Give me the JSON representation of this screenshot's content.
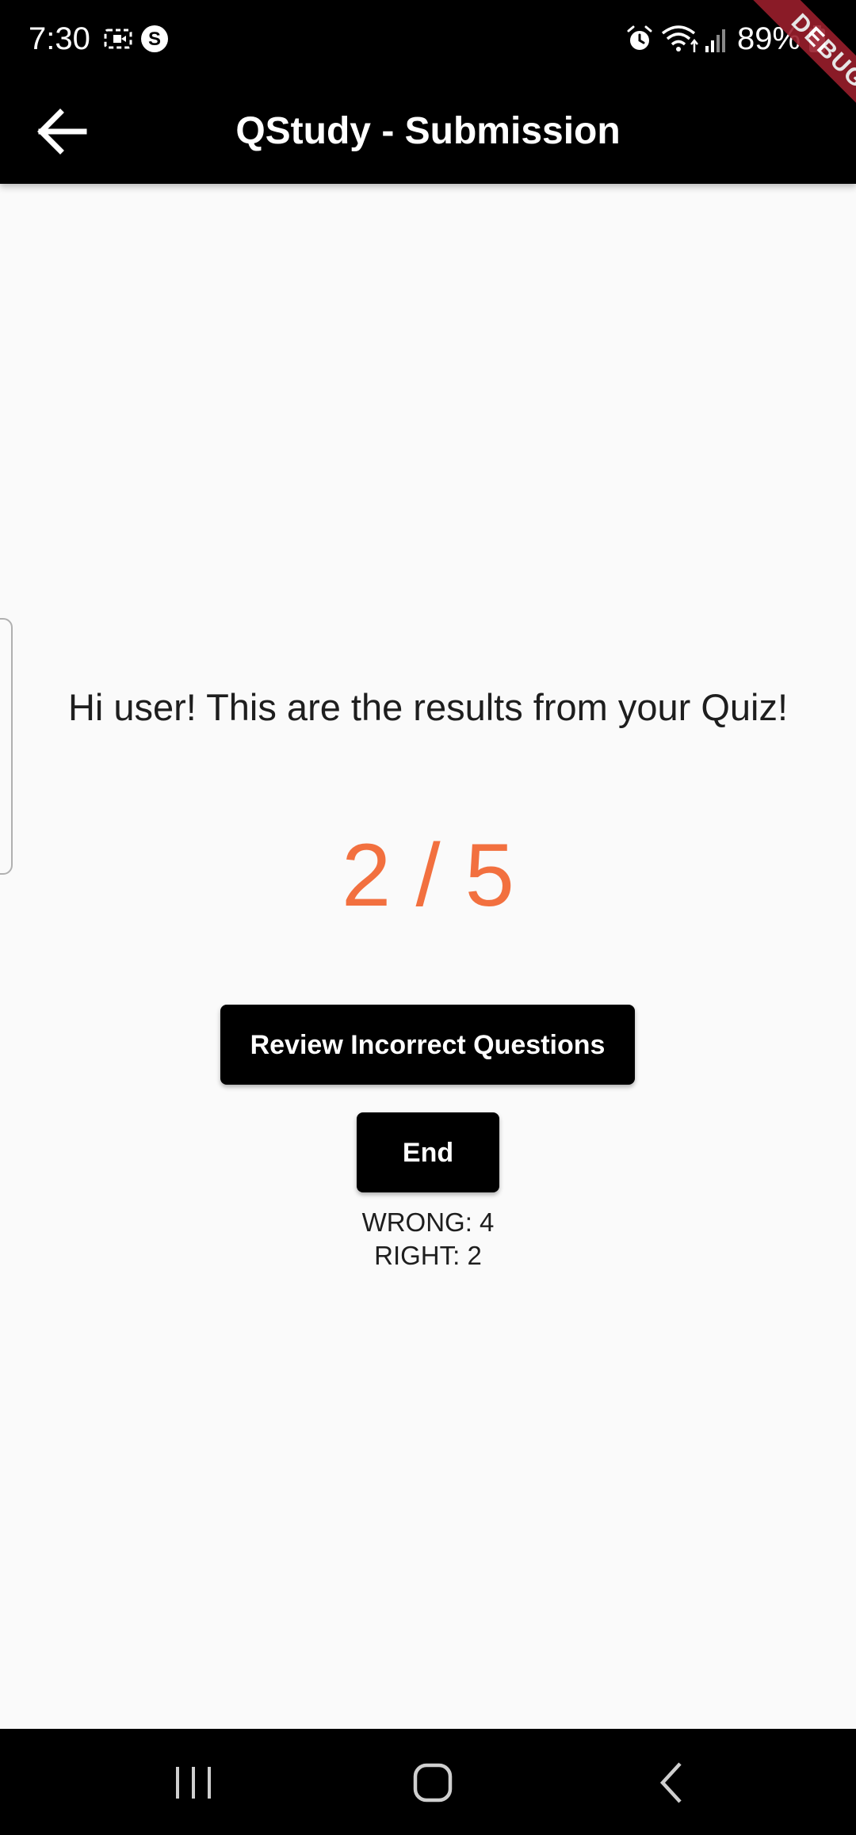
{
  "status_bar": {
    "time": "7:30",
    "battery_text": "89%",
    "icons": [
      "screen-recorder-icon",
      "s-app-icon",
      "alarm-icon",
      "wifi-icon",
      "signal-icon",
      "battery-icon"
    ]
  },
  "app_bar": {
    "title": "QStudy - Submission",
    "back_icon": "arrow-back-icon"
  },
  "debug_banner": "DEBUG",
  "results": {
    "greeting": "Hi user! This are the results from your Quiz!",
    "score": "2 / 5",
    "review_button": "Review Incorrect Questions",
    "end_button": "End",
    "wrong": "WRONG: 4",
    "right": "RIGHT: 2"
  },
  "colors": {
    "score": "#f2703f",
    "app_bar": "#000000",
    "button": "#000000",
    "background": "#fafafa",
    "debug_ribbon": "#9a1e2c"
  },
  "nav_bar": {
    "icons": [
      "recent-apps-icon",
      "home-icon",
      "back-nav-icon"
    ]
  }
}
